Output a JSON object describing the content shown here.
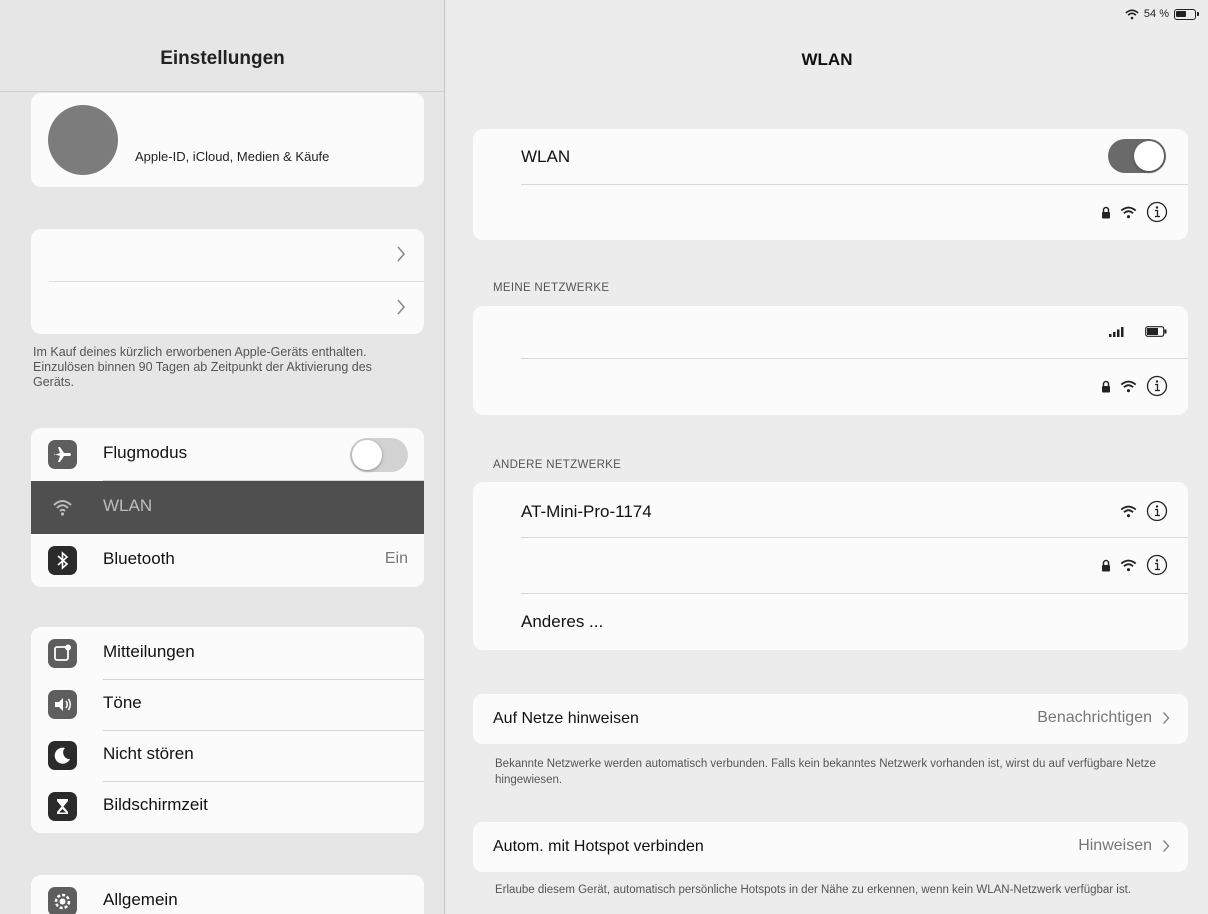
{
  "sidebar": {
    "title": "Einstellungen",
    "apple_account_label": "Apple-ID, iCloud, Medien & Käufe",
    "promo_note": "Im Kauf deines kürzlich erworbenen Apple-Geräts enthalten. Einzulösen binnen 90 Tagen ab Zeitpunkt der Aktivierung des Geräts.",
    "connectivity": {
      "airplane": {
        "label": "Flugmodus",
        "toggle": "off"
      },
      "wifi": {
        "label": "WLAN",
        "selected": true
      },
      "bluetooth": {
        "label": "Bluetooth",
        "value": "Ein"
      }
    },
    "notifications_group": [
      {
        "label": "Mitteilungen",
        "icon": "notifications-icon"
      },
      {
        "label": "Töne",
        "icon": "sounds-icon"
      },
      {
        "label": "Nicht stören",
        "icon": "moon-icon"
      },
      {
        "label": "Bildschirmzeit",
        "icon": "hourglass-icon"
      }
    ],
    "general": {
      "label": "Allgemein",
      "icon": "gear-icon"
    }
  },
  "status_bar": {
    "battery": "54 %"
  },
  "main": {
    "title": "WLAN",
    "wifi_toggle": {
      "label": "WLAN",
      "state": "on"
    },
    "my_networks_header": "MEINE NETZWERKE",
    "other_networks_header": "ANDERE NETZWERKE",
    "other_networks": [
      {
        "name": "AT-Mini-Pro-1174",
        "locked": false
      },
      {
        "name": "",
        "locked": true
      }
    ],
    "other_label": "Anderes ...",
    "ask_join": {
      "label": "Auf Netze hinweisen",
      "value": "Benachrichtigen",
      "footer": "Bekannte Netzwerke werden automatisch verbunden. Falls kein bekanntes Netzwerk vorhanden ist, wirst du auf verfügbare Netze hingewiesen."
    },
    "auto_hotspot": {
      "label": "Autom. mit Hotspot verbinden",
      "value": "Hinweisen",
      "footer": "Erlaube diesem Gerät, automatisch persönliche Hotspots in der Nähe zu erkennen, wenn kein WLAN-Netzwerk verfügbar ist."
    }
  },
  "colors": {
    "selected_row": "#4f4f4f",
    "toggle_on": "#6a6a6a"
  }
}
